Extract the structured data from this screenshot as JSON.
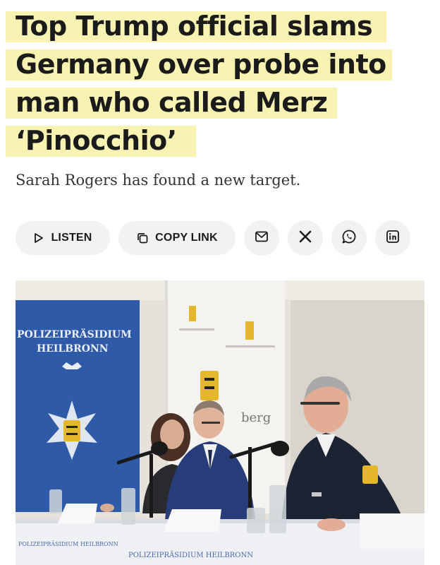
{
  "article": {
    "headline_lines": [
      "Top Trump official slams",
      "Germany over probe into",
      "man who called Merz",
      "‘Pinocchio’"
    ],
    "dek": "Sarah Rogers has found a new target."
  },
  "share": {
    "listen_label": "LISTEN",
    "copy_link_label": "COPY LINK",
    "icons": [
      "play-icon",
      "copy-icon",
      "mail-icon",
      "x-icon",
      "whatsapp-icon",
      "linkedin-icon"
    ]
  },
  "photo": {
    "banner_left_line1": "POLIZEIPRÄSIDIUM",
    "banner_left_line2": "HEILBRONN",
    "banner_right_partial": "berg",
    "tablecloth_text": "POLIZEIPRÄSIDIUM HEILBRONN",
    "highlight_color": "#f8f2b3",
    "banner_blue": "#2e5aa8"
  }
}
